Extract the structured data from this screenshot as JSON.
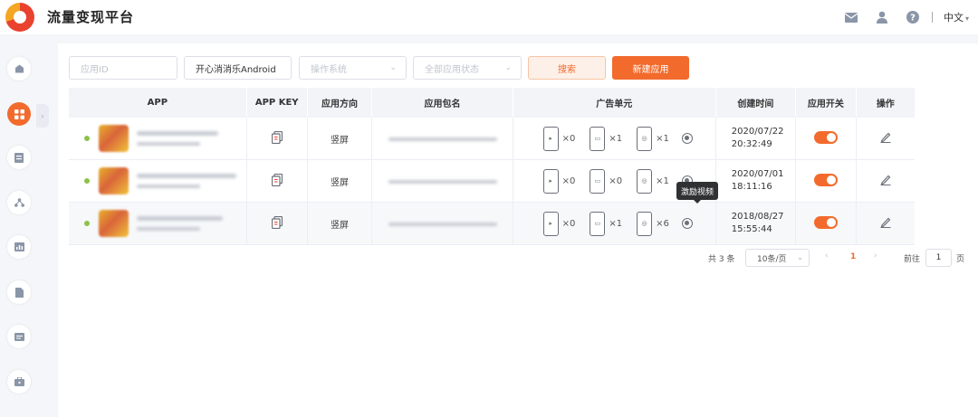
{
  "header": {
    "title": "流量变现平台",
    "icons": [
      "mail-icon",
      "user-icon",
      "help-icon"
    ],
    "language": "中文"
  },
  "sidebar": {
    "items": [
      "home",
      "apps",
      "reports",
      "structure",
      "analytics",
      "documents",
      "messages",
      "tools"
    ],
    "active": "apps"
  },
  "filters": {
    "app_id_placeholder": "应用ID",
    "app_name_value": "开心消消乐Android",
    "os_placeholder": "操作系统",
    "status_placeholder": "全部应用状态",
    "search_label": "搜索",
    "new_app_label": "新建应用"
  },
  "table": {
    "headers": [
      "APP",
      "APP KEY",
      "应用方向",
      "应用包名",
      "广告单元",
      "创建时间",
      "应用开关",
      "操作"
    ],
    "rows": [
      {
        "orientation": "竖屏",
        "ads": [
          "×0",
          "×1",
          "×1"
        ],
        "created_date": "2020/07/22",
        "created_time": "20:32:49"
      },
      {
        "orientation": "竖屏",
        "ads": [
          "×0",
          "×0",
          "×1"
        ],
        "created_date": "2020/07/01",
        "created_time": "18:11:16"
      },
      {
        "orientation": "竖屏",
        "ads": [
          "×0",
          "×1",
          "×6"
        ],
        "created_date": "2018/08/27",
        "created_time": "15:55:44"
      }
    ]
  },
  "tooltip": "激励视频",
  "pagination": {
    "total": "共 3 条",
    "page_size": "10条/页",
    "current": "1",
    "goto_label": "前往",
    "goto_value": "1",
    "page_unit": "页"
  },
  "colors": {
    "accent": "#f26b2d",
    "status_dot": "#8bc34a"
  }
}
